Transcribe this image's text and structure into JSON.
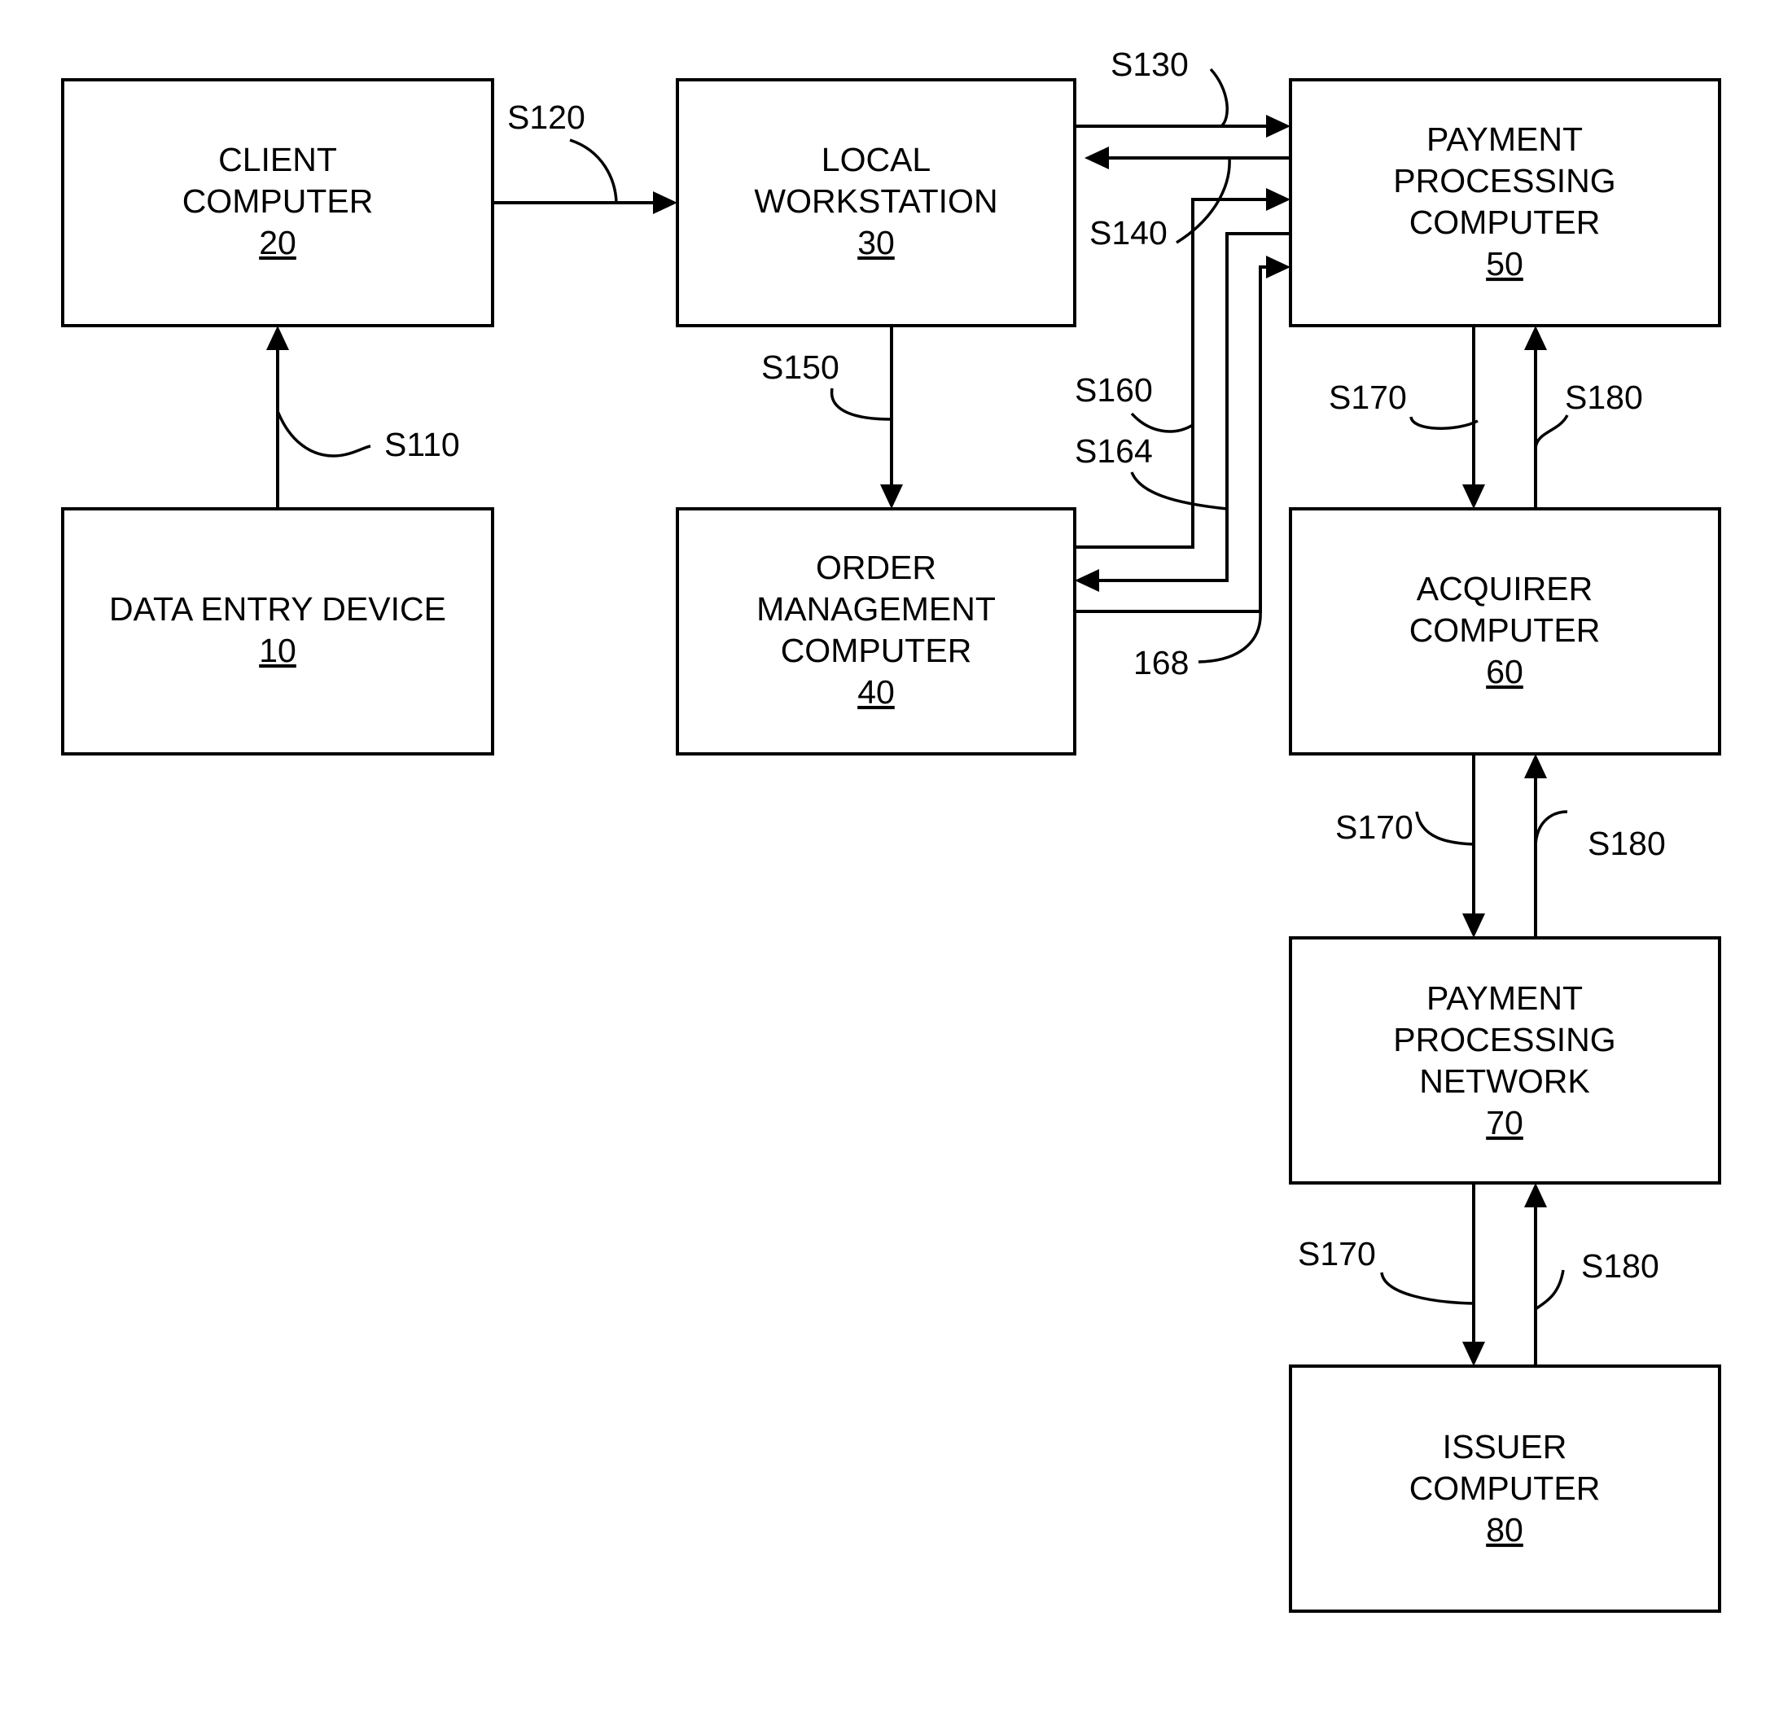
{
  "diagram": {
    "boxes": {
      "data_entry": {
        "lines": [
          "DATA ENTRY DEVICE"
        ],
        "ref": "10"
      },
      "client": {
        "lines": [
          "CLIENT",
          "COMPUTER"
        ],
        "ref": "20"
      },
      "workstation": {
        "lines": [
          "LOCAL",
          "WORKSTATION"
        ],
        "ref": "30"
      },
      "order_mgmt": {
        "lines": [
          "ORDER",
          "MANAGEMENT",
          "COMPUTER"
        ],
        "ref": "40"
      },
      "payment_proc": {
        "lines": [
          "PAYMENT",
          "PROCESSING",
          "COMPUTER"
        ],
        "ref": "50"
      },
      "acquirer": {
        "lines": [
          "ACQUIRER",
          "COMPUTER"
        ],
        "ref": "60"
      },
      "network": {
        "lines": [
          "PAYMENT",
          "PROCESSING",
          "NETWORK"
        ],
        "ref": "70"
      },
      "issuer": {
        "lines": [
          "ISSUER",
          "COMPUTER"
        ],
        "ref": "80"
      }
    },
    "labels": {
      "s110": "S110",
      "s120": "S120",
      "s130": "S130",
      "s140": "S140",
      "s150": "S150",
      "s160": "S160",
      "s164": "S164",
      "l168": "168",
      "s170_a": "S170",
      "s180_a": "S180",
      "s170_b": "S170",
      "s180_b": "S180",
      "s170_c": "S170",
      "s180_c": "S180"
    }
  }
}
